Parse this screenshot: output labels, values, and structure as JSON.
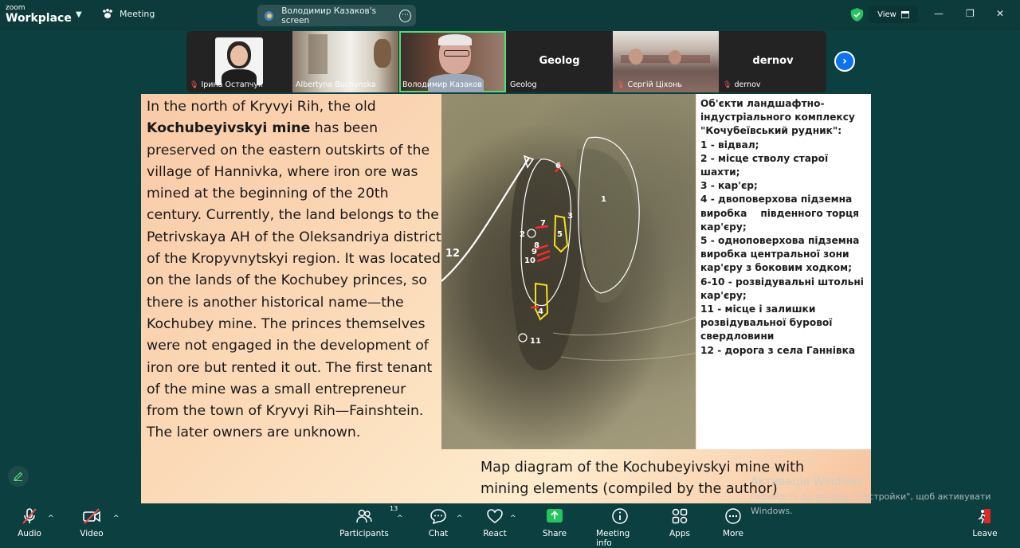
{
  "titlebar": {
    "brand_top": "zoom",
    "brand_bottom": "Workplace",
    "meeting_label": "Meeting",
    "share_label": "Володимир Казаков's screen",
    "view_label": "View"
  },
  "participants": [
    {
      "name": "Ірина Остапчук",
      "muted": true,
      "kind": "photo"
    },
    {
      "name": "Albertyna Buchynska",
      "muted": false,
      "kind": "photo"
    },
    {
      "name": "Володимир Казаков",
      "muted": false,
      "kind": "photo",
      "active": true
    },
    {
      "name": "Geolog",
      "muted": false,
      "kind": "name",
      "display": "Geolog"
    },
    {
      "name": "Сергій Ціхонь",
      "muted": true,
      "kind": "photo"
    },
    {
      "name": "dernov",
      "muted": true,
      "kind": "name",
      "display": "dernov"
    }
  ],
  "slide": {
    "text_before_bold": "In the north of Kryvyi Rih, the old ",
    "text_bold": "Kochubeyivskyi mine",
    "text_after_bold": " has been preserved on the eastern outskirts of the village of Hannivka, where iron ore was mined at the beginning of the 20th century. Currently, the land belongs to the Petrivskaya AH of the Oleksandriya district of the Kropyvnytskyi  region. It was located on the lands of the Kochubey princes, so there is another historical name—the Kochubey mine. The princes themselves were not engaged in the development of iron ore but rented it out. The first tenant of the mine was a small entrepreneur from the town of Kryvyi Rih—Fainshtein. The later owners are unknown.",
    "map_labels": [
      "1",
      "2",
      "3",
      "4",
      "5",
      "6",
      "7",
      "8",
      "9",
      "10",
      "11",
      "12"
    ],
    "legend": "Об'єкти ландшафтно-\nіндустріального комплексу\n\"Кочубеївський рудник\":\n1 - відвал;\n2 - місце стволу старої\nшахти;\n3 - кар'єр;\n4 - двоповерхова підземна\nвиробка    південного торця\nкар'єру;\n5 - одноповерхова підземна\nвиробка центральної зони\nкар'єру з боковим ходком;\n6-10 - розвідувальні штольні\nкар'єру;\n11 - місце і залишки\nрозвідувальної бурової\nсвердловини\n12 - дорога з села Ганнівка",
    "caption": "Map diagram of the Kochubeyivskyi mine with mining elements (compiled by the author)"
  },
  "watermark": {
    "title": "Активація Windows",
    "subtitle": "Перейдіть до розділу \"Настройки\", щоб активувати Windows."
  },
  "toolbar": {
    "audio": "Audio",
    "video": "Video",
    "participants": "Participants",
    "participants_count": "13",
    "chat": "Chat",
    "react": "React",
    "share": "Share",
    "meeting_info": "Meeting info",
    "apps": "Apps",
    "more": "More",
    "leave": "Leave"
  },
  "colors": {
    "background": "#0c3f3f",
    "share_green": "#22c55e",
    "active_tile": "#4be07a",
    "mute_red": "#ff5a5a",
    "next_blue": "#0e72ed"
  }
}
